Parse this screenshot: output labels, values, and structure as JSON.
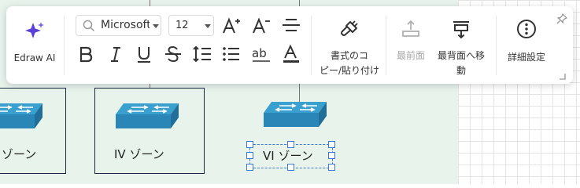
{
  "canvas": {
    "zones": [
      {
        "label": "ゾーン"
      },
      {
        "label": "IV ゾーン"
      },
      {
        "label": "VI ゾーン"
      }
    ]
  },
  "toolbar": {
    "ai": {
      "label": "Edraw AI",
      "icon": "sparkle-icon"
    },
    "font_family": {
      "value": "Microsoft"
    },
    "font_size": {
      "value": "12"
    },
    "format_painter": {
      "label_line1": "書式のコ",
      "label_line2": "ピー/貼り付け"
    },
    "bring_to_front": {
      "label": "最前面"
    },
    "send_to_back": {
      "label_line1": "最背面へ移",
      "label_line2": "動"
    },
    "details": {
      "label": "詳細設定"
    }
  },
  "colors": {
    "accent": "#5b3fd6",
    "canvas_bg": "#e8f3ec",
    "selection": "#3a79d6",
    "switch_top": "#3aa0cf",
    "switch_side": "#1f6f98"
  }
}
